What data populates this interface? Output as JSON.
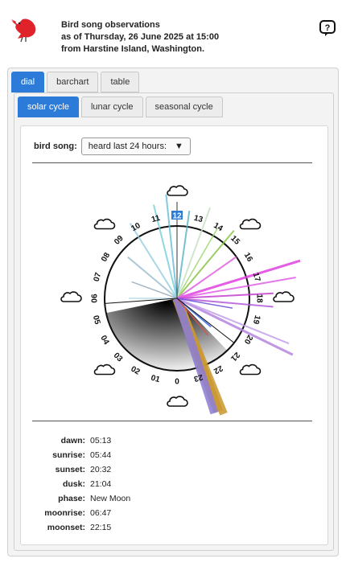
{
  "header": {
    "title_line1": "Bird song observations",
    "title_line2": "as of Thursday, 26 June 2025 at 15:00",
    "title_line3": "from Harstine Island, Washington.",
    "logo_icon": "red-bird-icon",
    "help_icon": "question-bubble-icon"
  },
  "tabs": [
    "dial",
    "barchart",
    "table"
  ],
  "active_tab": "dial",
  "subtabs": [
    "solar cycle",
    "lunar cycle",
    "seasonal cycle"
  ],
  "active_subtab": "solar cycle",
  "song": {
    "label": "bird song:",
    "selected": "heard last 24 hours:",
    "arrow": "▼"
  },
  "dial": {
    "hour_labels": [
      "0",
      "01",
      "02",
      "03",
      "04",
      "05",
      "06",
      "07",
      "08",
      "09",
      "10",
      "11",
      "12",
      "13",
      "14",
      "15",
      "16",
      "17",
      "18",
      "19",
      "20",
      "21",
      "22",
      "23"
    ],
    "highlighted_hour": "12",
    "weather_icon": "cloud-icon",
    "accent": "#2d7bd8"
  },
  "sun": [
    {
      "key": "dawn:",
      "value": "05:13"
    },
    {
      "key": "sunrise:",
      "value": "05:44"
    },
    {
      "key": "sunset:",
      "value": "20:32"
    },
    {
      "key": "dusk:",
      "value": "21:04"
    },
    {
      "key": "phase:",
      "value": "New Moon"
    },
    {
      "key": "moonrise:",
      "value": "06:47"
    },
    {
      "key": "moonset:",
      "value": "22:15"
    }
  ]
}
